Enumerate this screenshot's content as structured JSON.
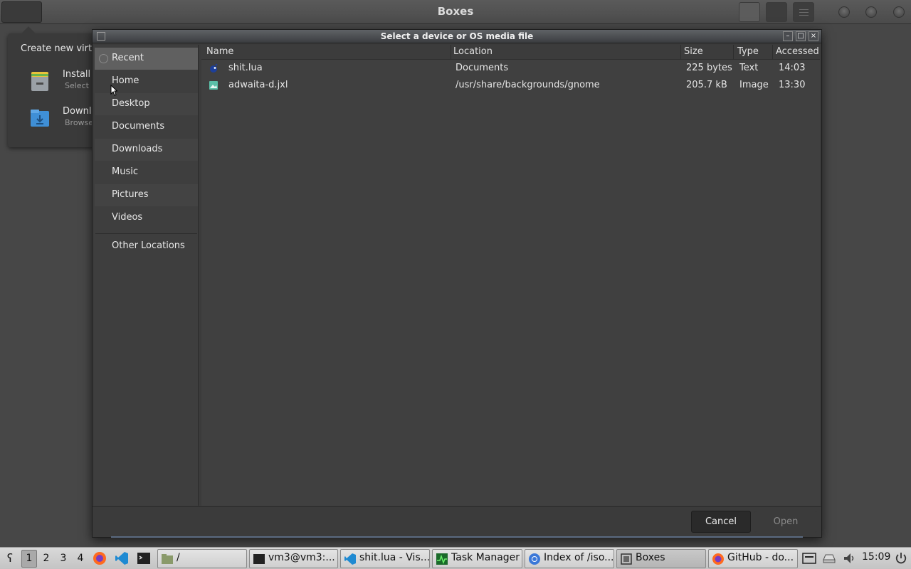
{
  "app": {
    "title": "Boxes"
  },
  "popover": {
    "title": "Create new virtu",
    "items": [
      {
        "label": "Install f",
        "sub": "Select a"
      },
      {
        "label": "Downlo",
        "sub": "Browse"
      }
    ]
  },
  "dialog": {
    "title": "Select a device or OS media file",
    "sidebar": [
      {
        "label": "Recent",
        "icon": "clock-icon"
      },
      {
        "label": "Home",
        "icon": "home-icon"
      },
      {
        "label": "Desktop",
        "icon": "desktop-icon"
      },
      {
        "label": "Documents",
        "icon": "documents-icon"
      },
      {
        "label": "Downloads",
        "icon": "downloads-icon"
      },
      {
        "label": "Music",
        "icon": "music-icon"
      },
      {
        "label": "Pictures",
        "icon": "pictures-icon"
      },
      {
        "label": "Videos",
        "icon": "videos-icon"
      },
      {
        "label": "Other Locations",
        "icon": "other-locations-icon"
      }
    ],
    "columns": [
      "Name",
      "Location",
      "Size",
      "Type",
      "Accessed"
    ],
    "files": [
      {
        "name": "shit.lua",
        "location": "Documents",
        "size": "225 bytes",
        "type": "Text",
        "accessed": "14:03",
        "icon": "lua-file-icon"
      },
      {
        "name": "adwaita-d.jxl",
        "location": "/usr/share/backgrounds/gnome",
        "size": "205.7 kB",
        "type": "Image",
        "accessed": "13:30",
        "icon": "image-file-icon"
      }
    ],
    "buttons": {
      "cancel": "Cancel",
      "open": "Open"
    }
  },
  "taskbar": {
    "workspaces": [
      "1",
      "2",
      "3",
      "4"
    ],
    "active_workspace": "1",
    "tasks": [
      {
        "label": "/",
        "icon": "folder-icon"
      },
      {
        "label": "vm3@vm3:...",
        "icon": "terminal-icon"
      },
      {
        "label": "shit.lua - Vis...",
        "icon": "vscode-icon"
      },
      {
        "label": "Task Manager",
        "icon": "task-manager-icon"
      },
      {
        "label": "Index of /iso...",
        "icon": "chromium-icon"
      },
      {
        "label": "Boxes",
        "icon": "boxes-icon"
      },
      {
        "label": "GitHub - do...",
        "icon": "firefox-icon"
      }
    ],
    "clock": "15:09"
  },
  "colors": {
    "selection": "#606060",
    "background": "#474747",
    "taskbar": "#cfcfcf"
  }
}
